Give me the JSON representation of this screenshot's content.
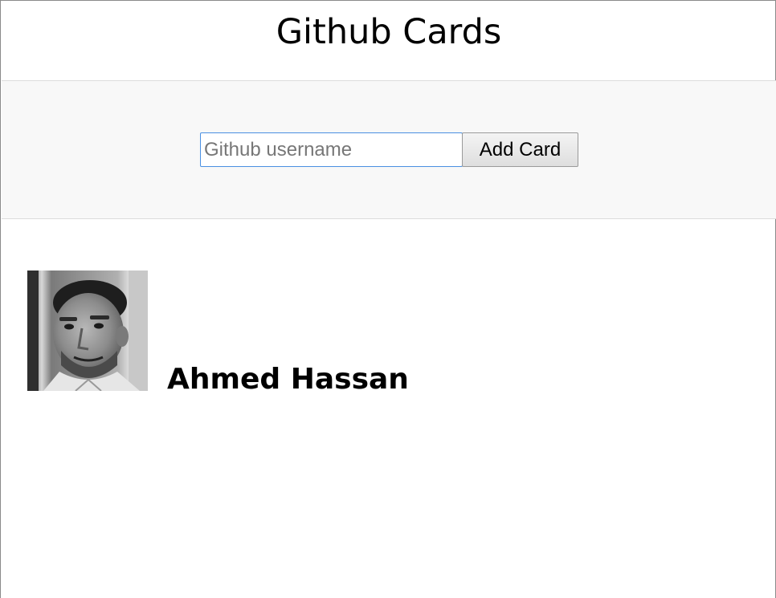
{
  "page": {
    "title": "Github Cards"
  },
  "form": {
    "input_placeholder": "Github username",
    "input_value": "",
    "add_button_label": "Add Card"
  },
  "cards": [
    {
      "name": "Ahmed Hassan",
      "avatar": "profile-photo"
    }
  ],
  "colors": {
    "input_focus_border": "#4a90e2",
    "form_band_background": "#f8f8f8",
    "divider": "#dcdcdc"
  }
}
